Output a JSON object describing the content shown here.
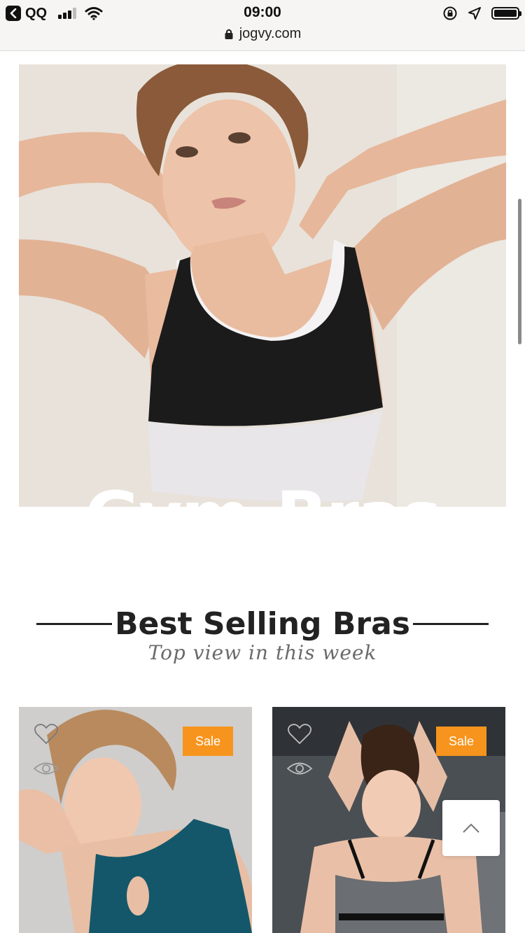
{
  "status_bar": {
    "back_app": "QQ",
    "time": "09:00"
  },
  "address_bar": {
    "url": "jogvy.com"
  },
  "hero": {
    "title": "Gym-Bras"
  },
  "section": {
    "title": "Best Selling Bras",
    "subtitle": "Top view in this week"
  },
  "products": [
    {
      "badge": "Sale"
    },
    {
      "badge": "Sale"
    }
  ],
  "colors": {
    "sale_badge": "#f7941d",
    "accent_text": "#222222"
  }
}
